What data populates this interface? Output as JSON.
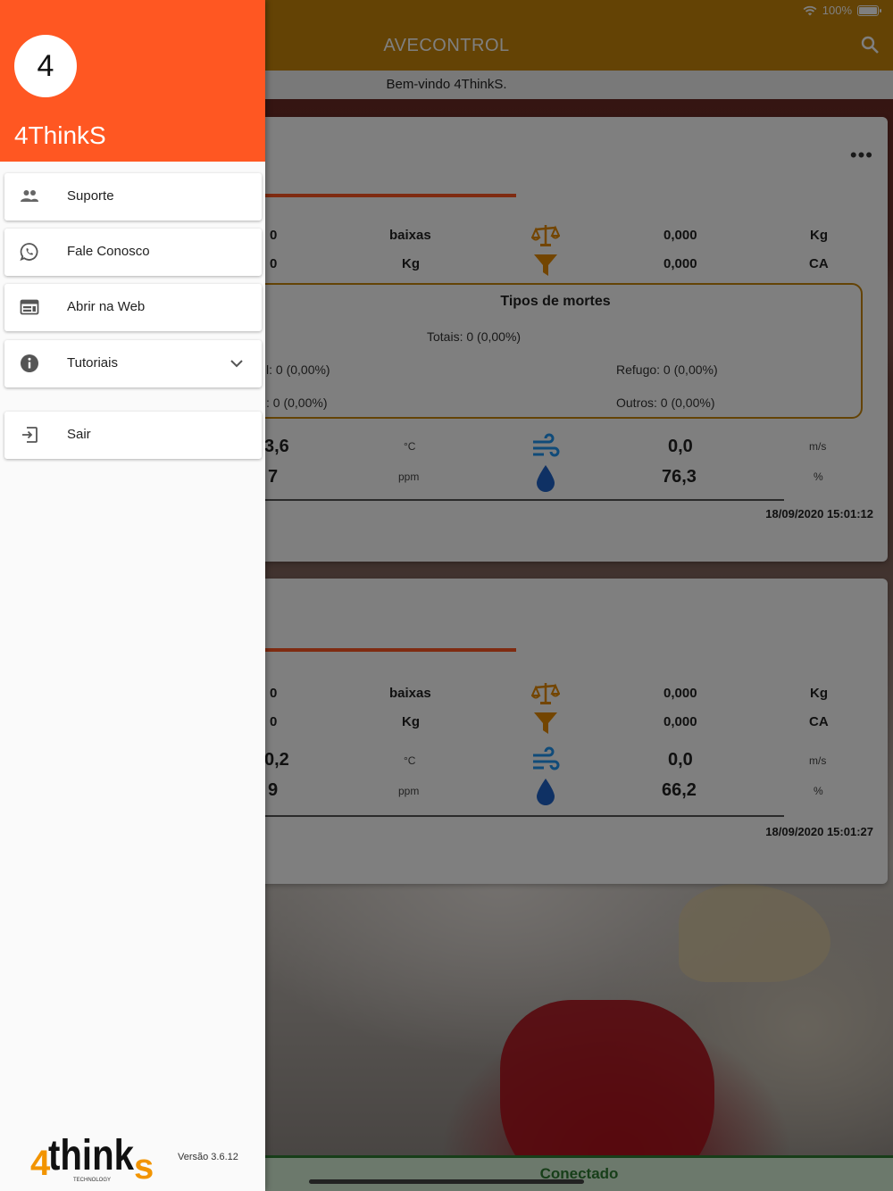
{
  "status_bar": {
    "battery": "100%"
  },
  "app": {
    "title": "AVECONTROL",
    "welcome": "Bem-vindo 4ThinkS."
  },
  "card1": {
    "more": "•••",
    "row1": {
      "value": "0",
      "unit": "baixas",
      "weight": "0,000",
      "weight_unit": "Kg"
    },
    "row2": {
      "value": "0",
      "unit": "Kg",
      "ca": "0,000",
      "ca_unit": "CA"
    },
    "deaths": {
      "title": "Tipos de mortes",
      "totals": "Totais: 0 (0,00%)",
      "left1": "l: 0 (0,00%)",
      "right1": "Refugo: 0 (0,00%)",
      "left2": ": 0 (0,00%)",
      "right2": "Outros: 0 (0,00%)"
    },
    "temp": {
      "value": "3,6",
      "unit": "°C",
      "wind": "0,0",
      "wind_unit": "m/s"
    },
    "gas": {
      "value": "7",
      "unit": "ppm",
      "humidity": "76,3",
      "humidity_unit": "%"
    },
    "timestamp": "18/09/2020 15:01:12"
  },
  "card2": {
    "row1": {
      "value": "0",
      "unit": "baixas",
      "weight": "0,000",
      "weight_unit": "Kg"
    },
    "row2": {
      "value": "0",
      "unit": "Kg",
      "ca": "0,000",
      "ca_unit": "CA"
    },
    "temp": {
      "value": "0,2",
      "unit": "°C",
      "wind": "0,0",
      "wind_unit": "m/s"
    },
    "gas": {
      "value": "9",
      "unit": "ppm",
      "humidity": "66,2",
      "humidity_unit": "%"
    },
    "timestamp": "18/09/2020 15:01:27"
  },
  "connection": "Conectado",
  "drawer": {
    "avatar_letter": "4",
    "user_name": "4ThinkS",
    "items": [
      {
        "label": "Suporte",
        "icon": "people-icon"
      },
      {
        "label": "Fale Conosco",
        "icon": "whatsapp-icon"
      },
      {
        "label": "Abrir na Web",
        "icon": "web-icon"
      },
      {
        "label": "Tutoriais",
        "icon": "info-icon"
      },
      {
        "label": "Sair",
        "icon": "exit-icon"
      }
    ],
    "logo_text": "4thinks",
    "logo_sub": "TECHNOLOGY",
    "version": "Versão 3.6.12"
  },
  "colors": {
    "accent": "#ff5722",
    "appbar": "#c8860b",
    "connected": "#2e7d32",
    "icon_blue": "#2196f3",
    "icon_orange": "#e68a00"
  }
}
